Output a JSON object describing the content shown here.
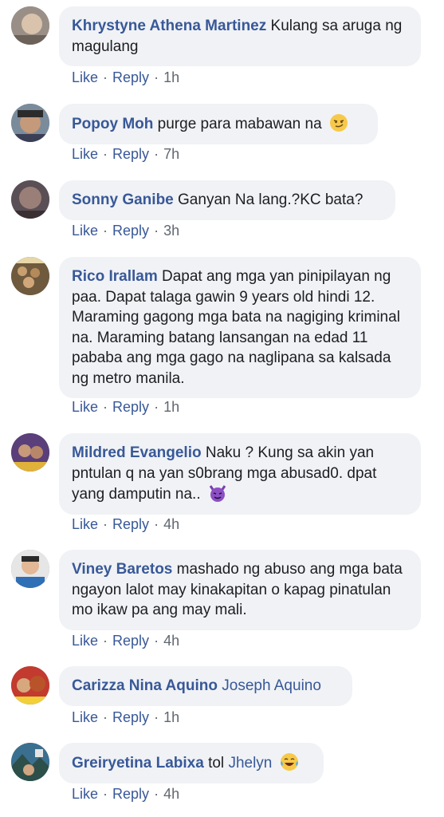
{
  "comments": [
    {
      "name": "Khrystyne Athena Martinez",
      "text": "Kulang sa aruga ng magulang",
      "like": "Like",
      "reply": "Reply",
      "time": "1h"
    },
    {
      "name": "Popoy Moh",
      "text": "purge para mabawan na",
      "emoji": "smirk-emoji",
      "like": "Like",
      "reply": "Reply",
      "time": "7h"
    },
    {
      "name": "Sonny Ganibe",
      "text": "Ganyan Na lang.?KC bata?",
      "like": "Like",
      "reply": "Reply",
      "time": "3h"
    },
    {
      "name": "Rico Irallam",
      "text": "Dapat ang mga yan pinipilayan ng paa. Dapat talaga gawin 9 years old hindi 12. Maraming gagong mga bata na nagiging kriminal na. Maraming batang lansangan na edad 11 pababa ang mga gago na naglipana sa kalsada ng metro manila.",
      "like": "Like",
      "reply": "Reply",
      "time": "1h"
    },
    {
      "name": "Mildred Evangelio",
      "text": "Naku ? Kung sa akin yan pntulan q na yan s0brang mga abusad0. dpat yang damputin na..",
      "emoji": "purple-devil-emoji",
      "like": "Like",
      "reply": "Reply",
      "time": "4h"
    },
    {
      "name": "Viney Baretos",
      "text": "mashado ng abuso ang mga bata ngayon lalot may kinakapitan o kapag pinatulan mo ikaw pa ang may mali.",
      "like": "Like",
      "reply": "Reply",
      "time": "4h"
    },
    {
      "name": "Carizza Nina Aquino",
      "mention": "Joseph Aquino",
      "like": "Like",
      "reply": "Reply",
      "time": "1h"
    },
    {
      "name": "Greiryetina Labixa",
      "text": "tol",
      "mention": "Jhelyn",
      "emoji": "laughing-tears-emoji",
      "like": "Like",
      "reply": "Reply",
      "time": "4h"
    }
  ],
  "colors": {
    "name": "#385898",
    "bubble": "#f0f2f5",
    "meta": "#606770"
  }
}
